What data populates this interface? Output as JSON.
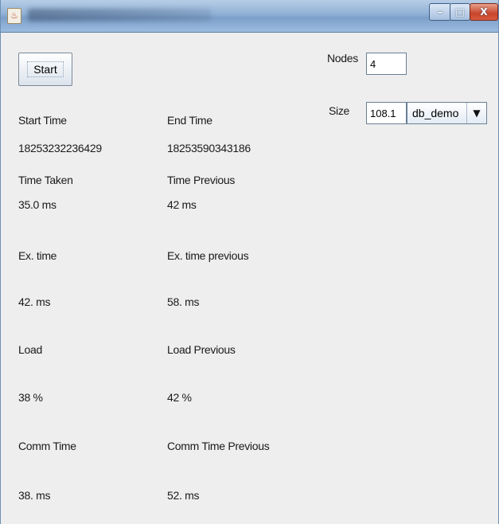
{
  "window": {
    "controls": {
      "minimize": "–",
      "maximize": "□",
      "close": "X"
    }
  },
  "controls": {
    "start_label": "Start",
    "nodes_label": "Nodes",
    "nodes_value": "4",
    "size_label": "Size",
    "size_value": "108.1",
    "db_selected": "db_demo"
  },
  "metrics": {
    "start_time_label": "Start Time",
    "start_time_value": "18253232236429",
    "end_time_label": "End Time",
    "end_time_value": "18253590343186",
    "time_taken_label": "Time Taken",
    "time_taken_value": "35.0 ms",
    "time_previous_label": "Time Previous",
    "time_previous_value": "42 ms",
    "ex_time_label": "Ex. time",
    "ex_time_value": "42. ms",
    "ex_time_previous_label": "Ex. time previous",
    "ex_time_previous_value": "58. ms",
    "load_label": "Load",
    "load_value": "38 %",
    "load_previous_label": "Load Previous",
    "load_previous_value": "42 %",
    "comm_time_label": "Comm Time",
    "comm_time_value": "38. ms",
    "comm_time_previous_label": "Comm Time Previous",
    "comm_time_previous_value": "52. ms"
  }
}
